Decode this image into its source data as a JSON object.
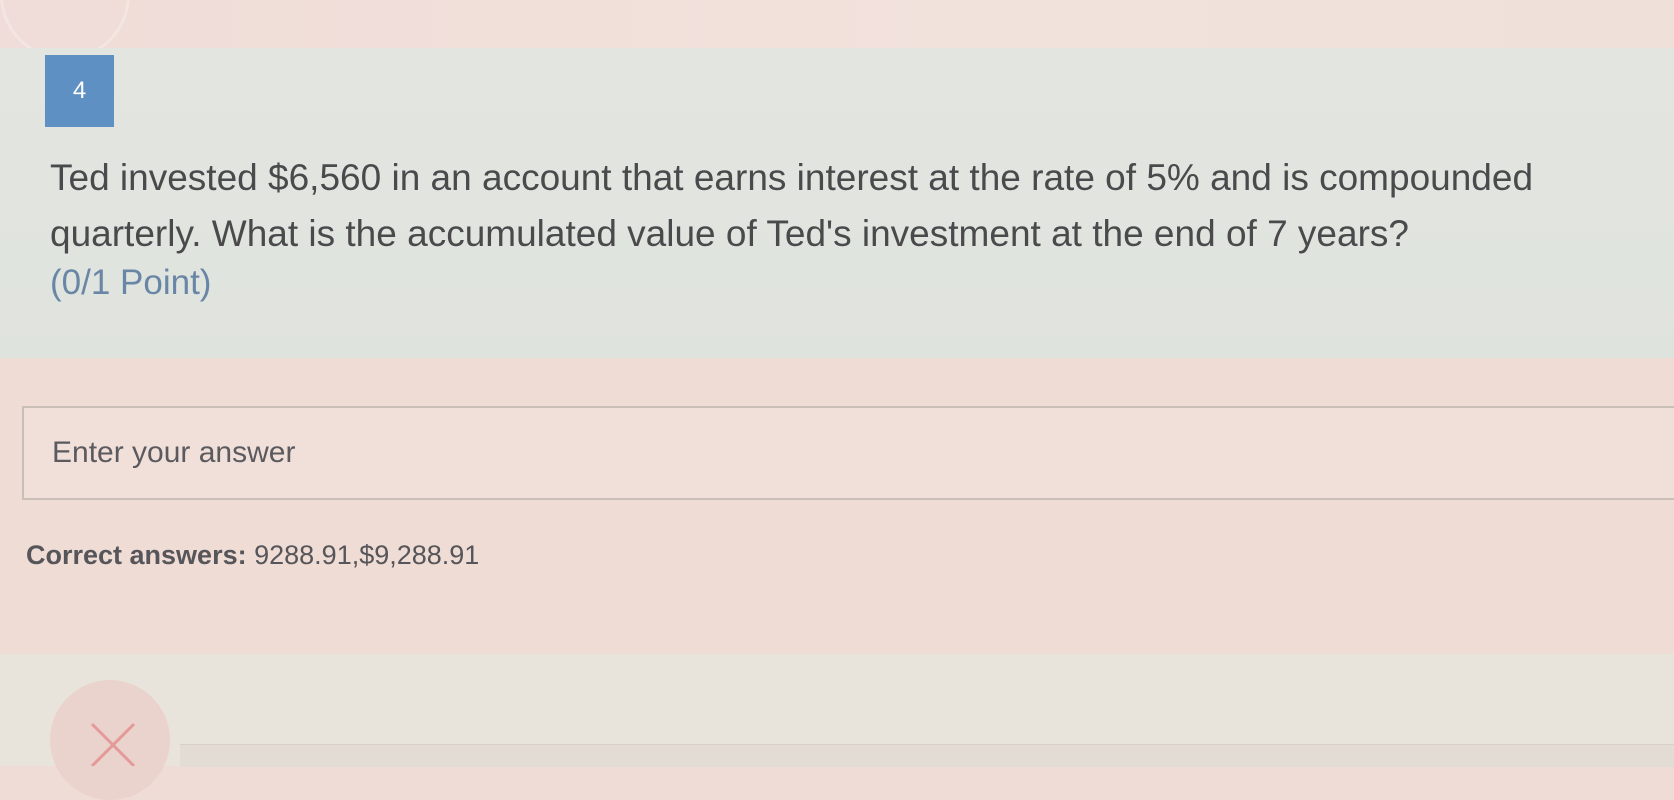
{
  "question": {
    "number": "4",
    "text": "Ted invested $6,560 in an account that earns interest at the rate of 5% and is compounded quarterly. What is the accumulated value of Ted's investment at the end of 7 years?",
    "points": "(0/1 Point)"
  },
  "answer": {
    "placeholder": "Enter your answer",
    "value": ""
  },
  "feedback": {
    "correct_label": "Correct answers:",
    "correct_values": "9288.91,$9,288.91"
  },
  "icons": {
    "incorrect_marker": "x-icon"
  },
  "colors": {
    "question_number_bg": "#5f90c4",
    "points_text": "#6a86a6",
    "incorrect_mark": "#e59a9a"
  }
}
